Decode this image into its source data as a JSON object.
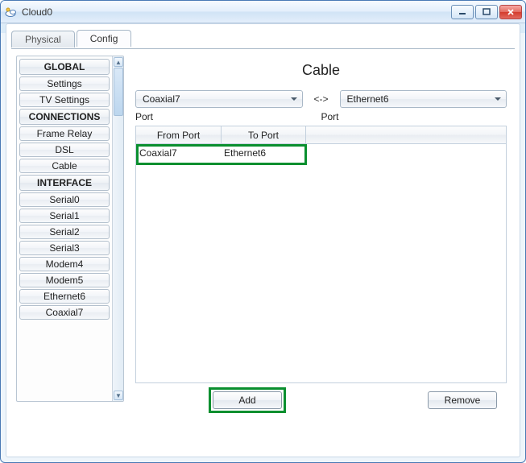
{
  "window": {
    "title": "Cloud0"
  },
  "tabs": {
    "physical": "Physical",
    "config": "Config"
  },
  "sidebar": {
    "groups": [
      {
        "header": "GLOBAL",
        "items": [
          "Settings",
          "TV Settings"
        ]
      },
      {
        "header": "CONNECTIONS",
        "items": [
          "Frame Relay",
          "DSL",
          "Cable"
        ]
      },
      {
        "header": "INTERFACE",
        "items": [
          "Serial0",
          "Serial1",
          "Serial2",
          "Serial3",
          "Modem4",
          "Modem5",
          "Ethernet6",
          "Coaxial7"
        ]
      }
    ]
  },
  "main": {
    "title": "Cable",
    "left_combo": "Coaxial7",
    "mid": "<->",
    "right_combo": "Ethernet6",
    "port_label": "Port",
    "cols": {
      "from": "From Port",
      "to": "To Port"
    },
    "rows": [
      {
        "from": "Coaxial7",
        "to": "Ethernet6"
      }
    ],
    "buttons": {
      "add": "Add",
      "remove": "Remove"
    }
  }
}
